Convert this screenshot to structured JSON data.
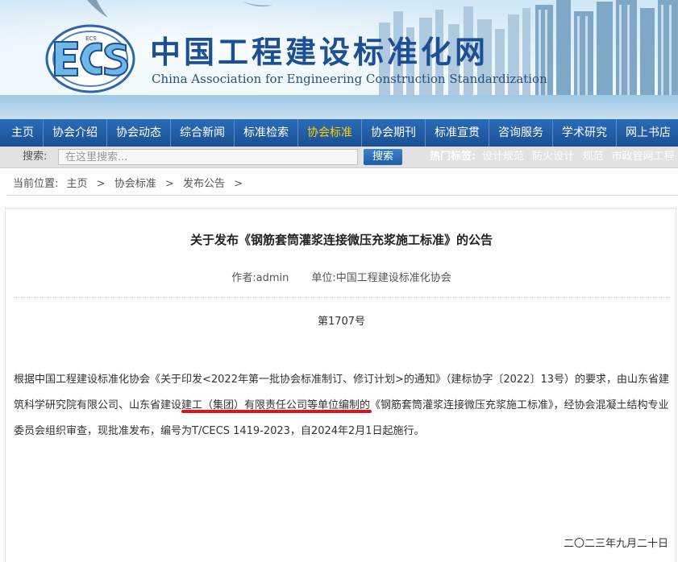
{
  "header": {
    "logo_text": "ECS",
    "title_cn": "中国工程建设标准化网",
    "title_en": "China Association for Engineering Construction Standardization"
  },
  "nav": {
    "items": [
      {
        "label": "主页",
        "active": false
      },
      {
        "label": "协会介绍",
        "active": false
      },
      {
        "label": "协会动态",
        "active": false
      },
      {
        "label": "综合新闻",
        "active": false
      },
      {
        "label": "标准检索",
        "active": false
      },
      {
        "label": "协会标准",
        "active": true
      },
      {
        "label": "协会期刊",
        "active": false
      },
      {
        "label": "标准宣贯",
        "active": false
      },
      {
        "label": "咨询服务",
        "active": false
      },
      {
        "label": "学术研究",
        "active": false
      },
      {
        "label": "网上书店",
        "active": false
      }
    ],
    "active_color": "#ffd200"
  },
  "search": {
    "label": "搜索:",
    "placeholder": "在这里搜索...",
    "button_label": "搜索",
    "hot_label": "热门标签:",
    "hot_tags": [
      "设计规范",
      "防火设计",
      "规范",
      "市政管网工程"
    ]
  },
  "breadcrumb": {
    "lead": "当前位置:",
    "items": [
      "主页",
      "协会标准",
      "发布公告"
    ],
    "separator": ">"
  },
  "article": {
    "title": "关于发布《钢筋套筒灌浆连接微压充浆施工标准》的公告",
    "author": "作者:admin",
    "unit": "单位:中国工程建设标准化协会",
    "doc_number": "第1707号",
    "body_part1": "根据中国工程建设标准化协会《关于印发<2022年第一批协会标准制订、修订计划>的通知》（建标协字〔2022〕13号）的要求，由山东省建筑科学研究院有限公司、",
    "body_highlight": "山东省建设建工（集团）有限责任公司",
    "body_part2": "等单位编制的《钢筋套筒灌浆连接微压充浆施工标准》，经协会混凝土结构专业委员会组织审查，现批准发布，编号为T/CECS 1419-2023，自2024年2月1日起施行。",
    "date": "二〇二三年九月二十日",
    "highlight_color": "#e0121b"
  },
  "colors": {
    "nav_bg": "#1a4f93",
    "brand_blue": "#1c4f94",
    "search_button": "#1e5ea9"
  }
}
